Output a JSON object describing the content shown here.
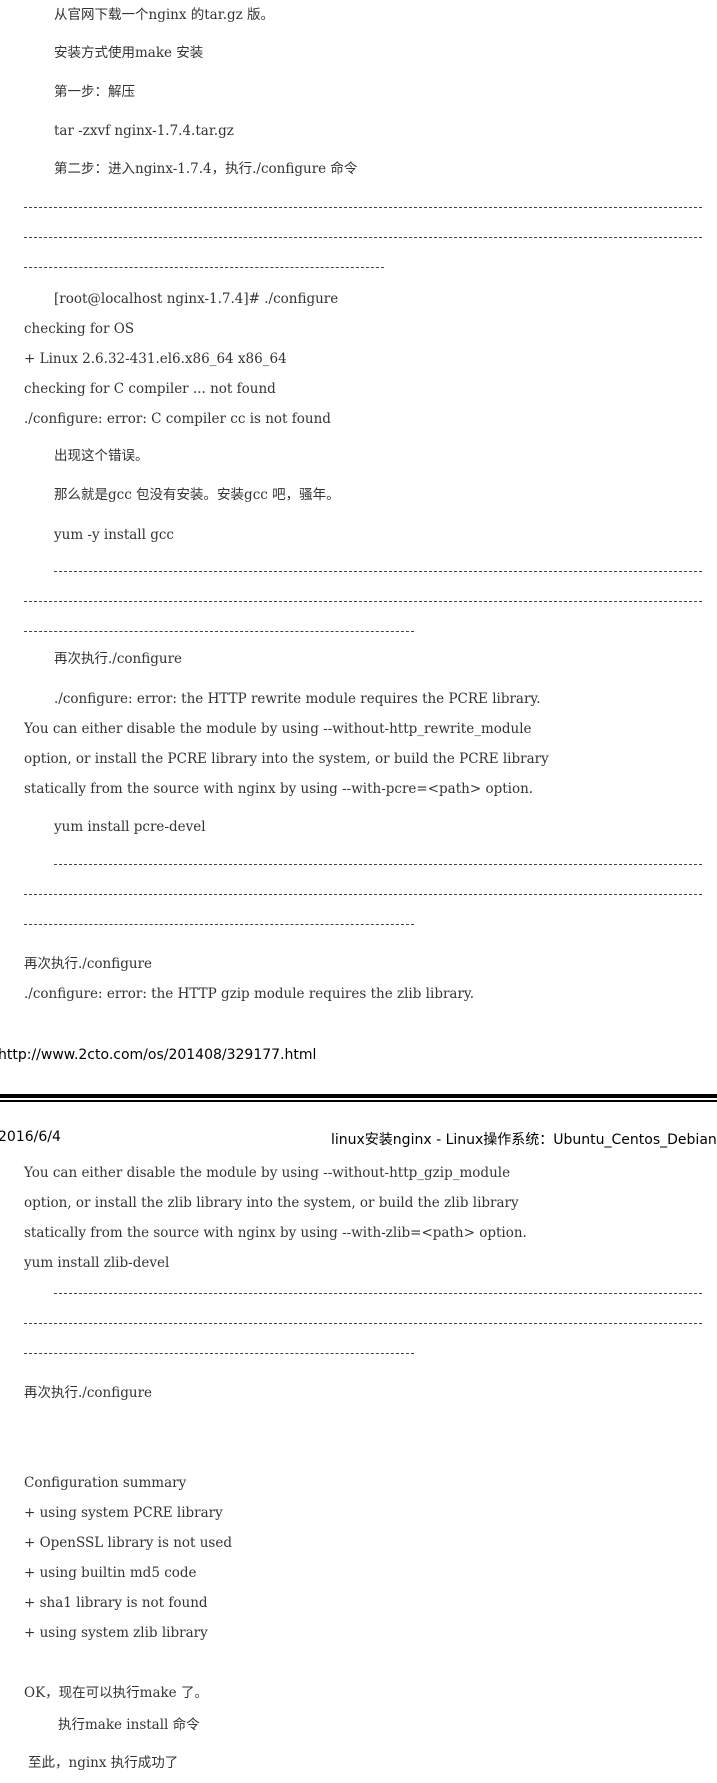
{
  "page1": {
    "l1": "从官网下载一个nginx 的tar.gz 版。",
    "l2": "安装方式使用make 安装",
    "l3": "第一步：解压",
    "l4": "tar -zxvf nginx-1.7.4.tar.gz",
    "l5": "第二步：进入nginx-1.7.4，执行./configure 命令",
    "l6": "[root@localhost nginx-1.7.4]# ./configure",
    "l7": "checking for OS",
    "l8": "+ Linux 2.6.32-431.el6.x86_64 x86_64",
    "l9": "checking for C compiler ... not found",
    "l10": "./configure: error: C compiler cc is not found",
    "l11": "出现这个错误。",
    "l12": "那么就是gcc 包没有安装。安装gcc 吧，骚年。",
    "l13": "yum -y install gcc",
    "l14": "再次执行./configure",
    "l15": "./configure: error: the HTTP rewrite module requires the PCRE library.",
    "l16": "You can either disable the module by using --without-http_rewrite_module",
    "l17": "option, or install the PCRE library into the system, or build the PCRE library",
    "l18": "statically from the source with nginx by using --with-pcre=<path> option.",
    "l19": "yum install pcre-devel",
    "l20": "再次执行./configure",
    "l21": "./configure: error: the HTTP gzip module requires the zlib library."
  },
  "footer": {
    "url": "http://www.2cto.com/os/201408/329177.html"
  },
  "header": {
    "date": "2016/6/4",
    "title": "linux安装nginx - Linux操作系统：Ubuntu_Centos_Debian -"
  },
  "page2": {
    "l1": "You can either disable the module by using --without-http_gzip_module",
    "l2": "option, or install the zlib library into the system, or build the zlib library",
    "l3": "statically from the source with nginx by using --with-zlib=<path> option.",
    "l4": "yum install zlib-devel",
    "l5": "再次执行./configure",
    "l6": "Configuration summary",
    "l7": "+ using system PCRE library",
    "l8": "+ OpenSSL library is not used",
    "l9": "+ using builtin md5 code",
    "l10": "+ sha1 library is not found",
    "l11": "+ using system zlib library",
    "l12": "OK，现在可以执行make 了。",
    "l13": "执行make install 命令",
    "l14": "至此，nginx 执行成功了"
  }
}
